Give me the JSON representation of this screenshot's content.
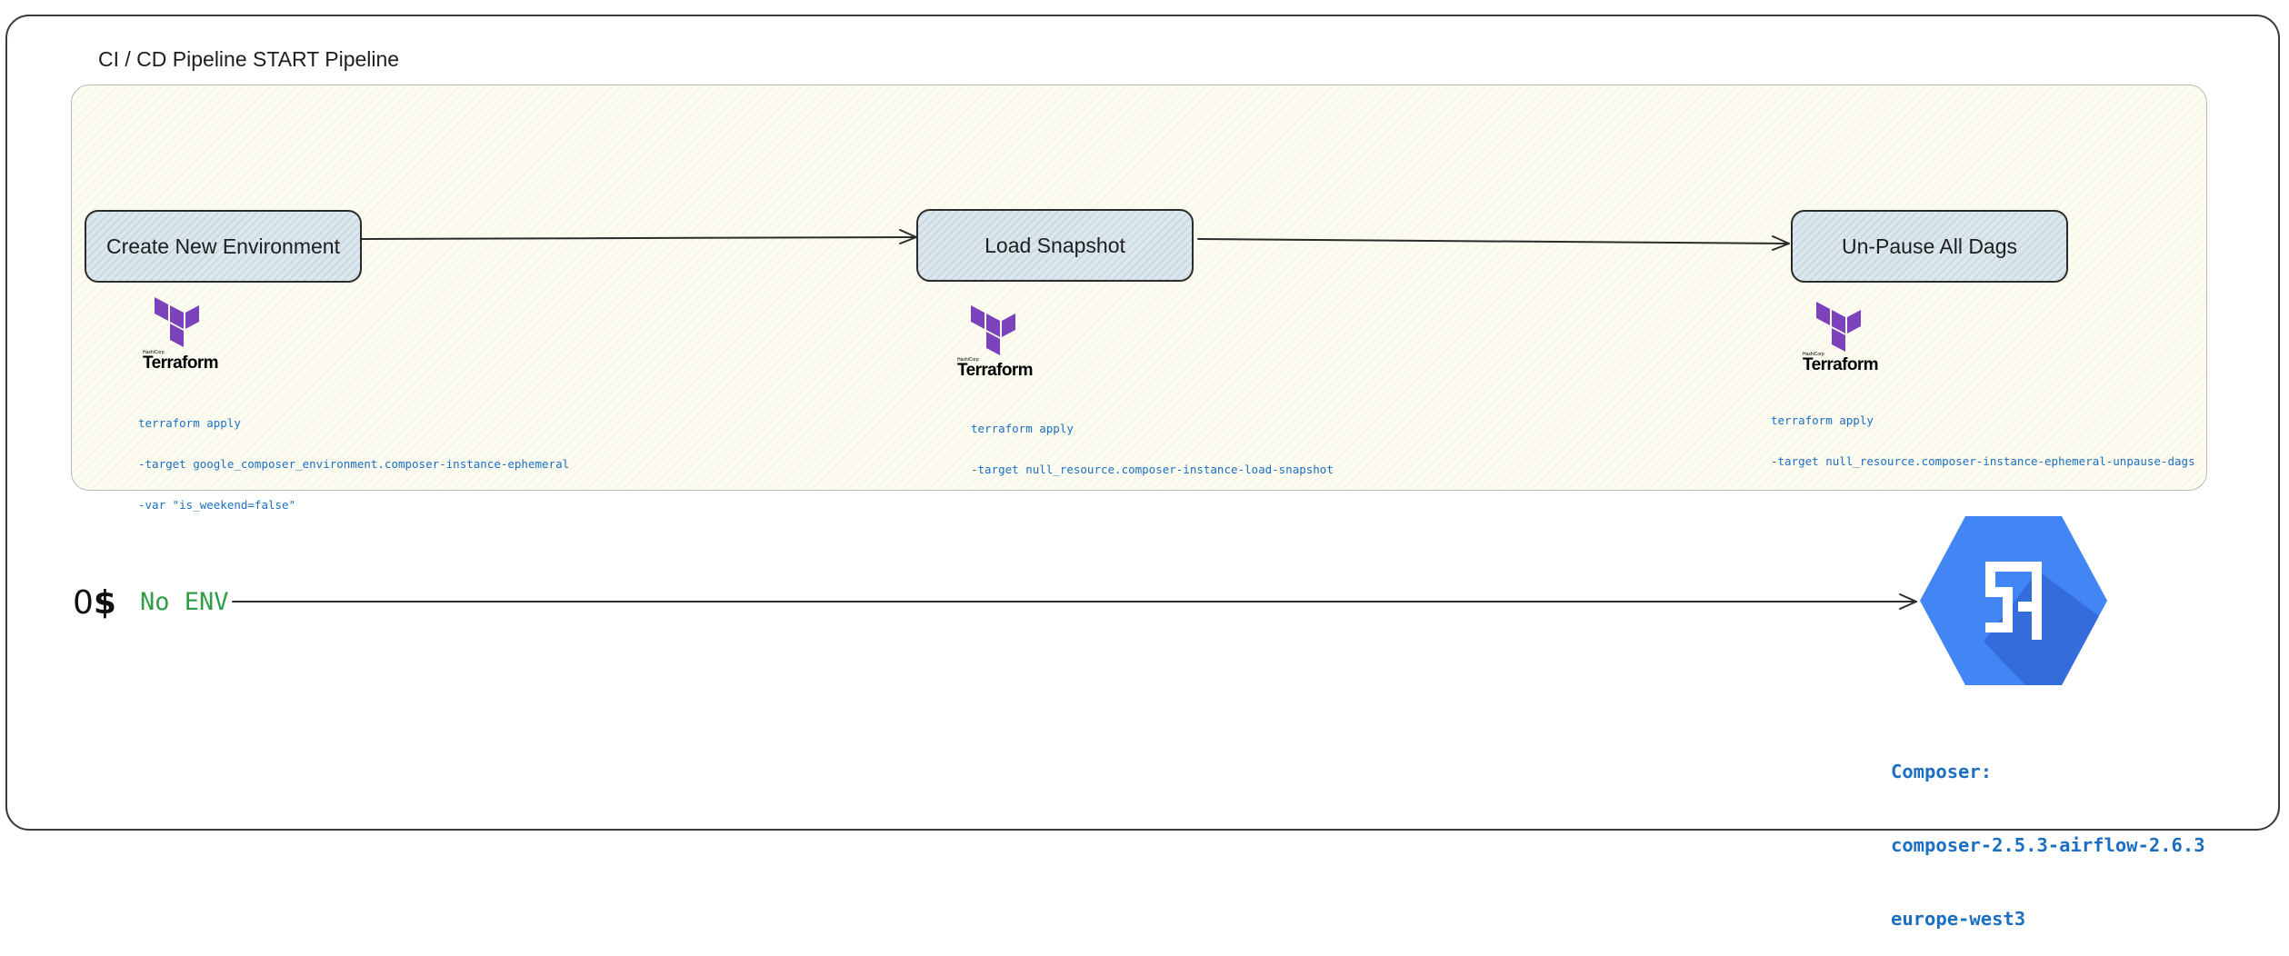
{
  "section_title": "CI / CD Pipeline START Pipeline",
  "steps": [
    {
      "label": "Create New Environment",
      "tool": "Terraform",
      "tool_vendor": "HashiCorp",
      "command": [
        "terraform apply",
        "-target google_composer_environment.composer-instance-ephemeral",
        "-var \"is_weekend=false\""
      ]
    },
    {
      "label": "Load Snapshot",
      "tool": "Terraform",
      "tool_vendor": "HashiCorp",
      "command": [
        "terraform apply",
        "-target null_resource.composer-instance-load-snapshot"
      ]
    },
    {
      "label": "Un-Pause All Dags",
      "tool": "Terraform",
      "tool_vendor": "HashiCorp",
      "command": [
        "terraform apply",
        "-target null_resource.composer-instance-ephemeral-unpause-dags"
      ]
    }
  ],
  "cost": {
    "amount": "0",
    "symbol": "$",
    "label": "No ENV"
  },
  "composer": {
    "lines": [
      "Composer:",
      "composer-2.5.3-airflow-2.6.3",
      "europe-west3"
    ]
  },
  "colors": {
    "terraform": "#7b42bc",
    "command_text": "#1c6fc0",
    "no_env": "#2f9e44",
    "composer_hex": "#4285f4",
    "step_fill": "#dde8ee",
    "panel_fill": "#fdfcf1"
  },
  "icons": [
    "terraform-logo",
    "composer-logo"
  ]
}
